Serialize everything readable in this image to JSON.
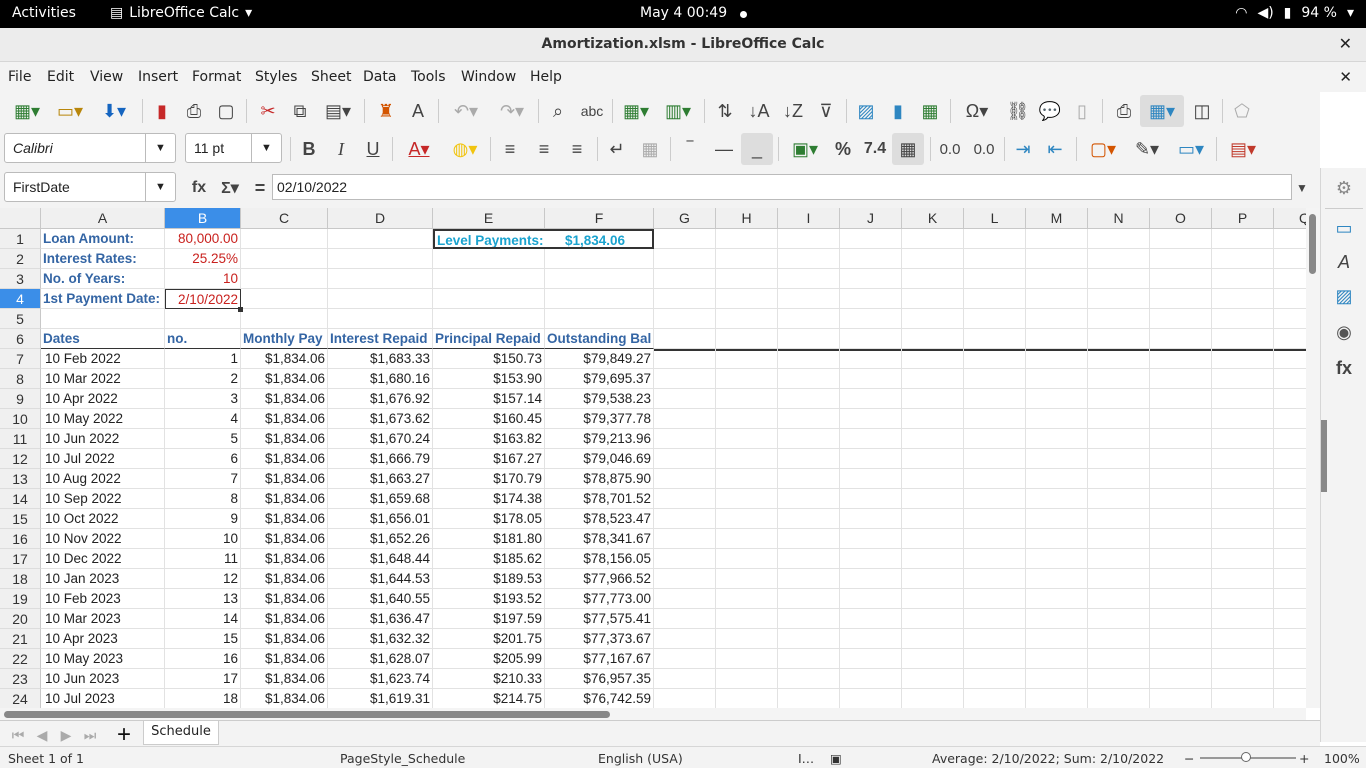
{
  "topbar": {
    "activities": "Activities",
    "app_name": "LibreOffice Calc",
    "clock": "May 4  00:49",
    "battery": "94 %"
  },
  "window": {
    "title": "Amortization.xlsm - LibreOffice Calc"
  },
  "menu": [
    "File",
    "Edit",
    "View",
    "Insert",
    "Format",
    "Styles",
    "Sheet",
    "Data",
    "Tools",
    "Window",
    "Help"
  ],
  "font": {
    "name": "Calibri",
    "size": "11 pt"
  },
  "formula": {
    "namebox": "FirstDate",
    "content": "02/10/2022"
  },
  "columns": [
    "A",
    "B",
    "C",
    "D",
    "E",
    "F",
    "G",
    "H",
    "I",
    "J",
    "K",
    "L",
    "M",
    "N",
    "O",
    "P",
    "Q"
  ],
  "header_rows": {
    "r1": {
      "a": "Loan Amount:",
      "b": "80,000.00",
      "e": "Level Payments:",
      "f": "$1,834.06"
    },
    "r2": {
      "a": "Interest Rates:",
      "b": "25.25%"
    },
    "r3": {
      "a": "No. of Years:",
      "b": "10"
    },
    "r4": {
      "a": "1st Payment Date:",
      "b": "2/10/2022"
    },
    "r6": {
      "a": "Dates",
      "b": "no.",
      "c": "Monthly Pay",
      "d": "Interest Repaid",
      "e": "Principal Repaid",
      "f": "Outstanding Bal"
    }
  },
  "schedule": [
    [
      "10 Feb 2022",
      "1",
      "$1,834.06",
      "$1,683.33",
      "$150.73",
      "$79,849.27"
    ],
    [
      "10 Mar 2022",
      "2",
      "$1,834.06",
      "$1,680.16",
      "$153.90",
      "$79,695.37"
    ],
    [
      "10 Apr 2022",
      "3",
      "$1,834.06",
      "$1,676.92",
      "$157.14",
      "$79,538.23"
    ],
    [
      "10 May 2022",
      "4",
      "$1,834.06",
      "$1,673.62",
      "$160.45",
      "$79,377.78"
    ],
    [
      "10 Jun 2022",
      "5",
      "$1,834.06",
      "$1,670.24",
      "$163.82",
      "$79,213.96"
    ],
    [
      "10 Jul 2022",
      "6",
      "$1,834.06",
      "$1,666.79",
      "$167.27",
      "$79,046.69"
    ],
    [
      "10 Aug 2022",
      "7",
      "$1,834.06",
      "$1,663.27",
      "$170.79",
      "$78,875.90"
    ],
    [
      "10 Sep 2022",
      "8",
      "$1,834.06",
      "$1,659.68",
      "$174.38",
      "$78,701.52"
    ],
    [
      "10 Oct 2022",
      "9",
      "$1,834.06",
      "$1,656.01",
      "$178.05",
      "$78,523.47"
    ],
    [
      "10 Nov 2022",
      "10",
      "$1,834.06",
      "$1,652.26",
      "$181.80",
      "$78,341.67"
    ],
    [
      "10 Dec 2022",
      "11",
      "$1,834.06",
      "$1,648.44",
      "$185.62",
      "$78,156.05"
    ],
    [
      "10 Jan 2023",
      "12",
      "$1,834.06",
      "$1,644.53",
      "$189.53",
      "$77,966.52"
    ],
    [
      "10 Feb 2023",
      "13",
      "$1,834.06",
      "$1,640.55",
      "$193.52",
      "$77,773.00"
    ],
    [
      "10 Mar 2023",
      "14",
      "$1,834.06",
      "$1,636.47",
      "$197.59",
      "$77,575.41"
    ],
    [
      "10 Apr 2023",
      "15",
      "$1,834.06",
      "$1,632.32",
      "$201.75",
      "$77,373.67"
    ],
    [
      "10 May 2023",
      "16",
      "$1,834.06",
      "$1,628.07",
      "$205.99",
      "$77,167.67"
    ],
    [
      "10 Jun 2023",
      "17",
      "$1,834.06",
      "$1,623.74",
      "$210.33",
      "$76,957.35"
    ],
    [
      "10 Jul 2023",
      "18",
      "$1,834.06",
      "$1,619.31",
      "$214.75",
      "$76,742.59"
    ]
  ],
  "tabs": {
    "sheet": "Schedule"
  },
  "status": {
    "sheet": "Sheet 1 of 1",
    "pagestyle": "PageStyle_Schedule",
    "language": "English (USA)",
    "summary": "Average: 2/10/2022; Sum: 2/10/2022",
    "zoom": "100%"
  }
}
